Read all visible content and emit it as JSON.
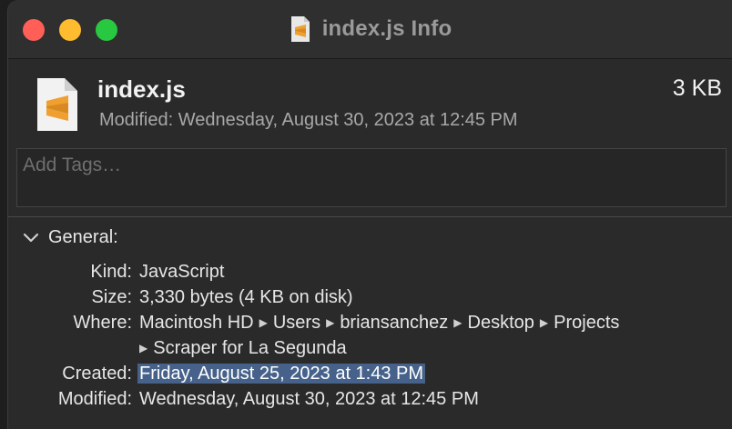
{
  "window": {
    "title": "index.js Info"
  },
  "header": {
    "file_name": "index.js",
    "file_size": "3 KB",
    "modified_line": "Modified: Wednesday, August 30, 2023 at 12:45 PM"
  },
  "tags": {
    "placeholder": "Add Tags…"
  },
  "general": {
    "section_label": "General:",
    "kind_label": "Kind:",
    "kind_value": "JavaScript",
    "size_label": "Size:",
    "size_value": "3,330 bytes (4 KB on disk)",
    "where_label": "Where:",
    "where_path": [
      "Macintosh HD",
      "Users",
      "briansanchez",
      "Desktop",
      "Projects",
      "Scraper for La Segunda"
    ],
    "created_label": "Created:",
    "created_value": "Friday, August 25, 2023 at 1:43 PM",
    "modified_label": "Modified:",
    "modified_value": "Wednesday, August 30, 2023 at 12:45 PM"
  },
  "colors": {
    "close": "#ff5f57",
    "minimize": "#febc2e",
    "maximize": "#28c840",
    "selection": "#46628a",
    "doc_accent": "#f0a030"
  },
  "icons": {
    "file": "sublime-document-icon",
    "disclosure": "chevron-down-icon"
  }
}
